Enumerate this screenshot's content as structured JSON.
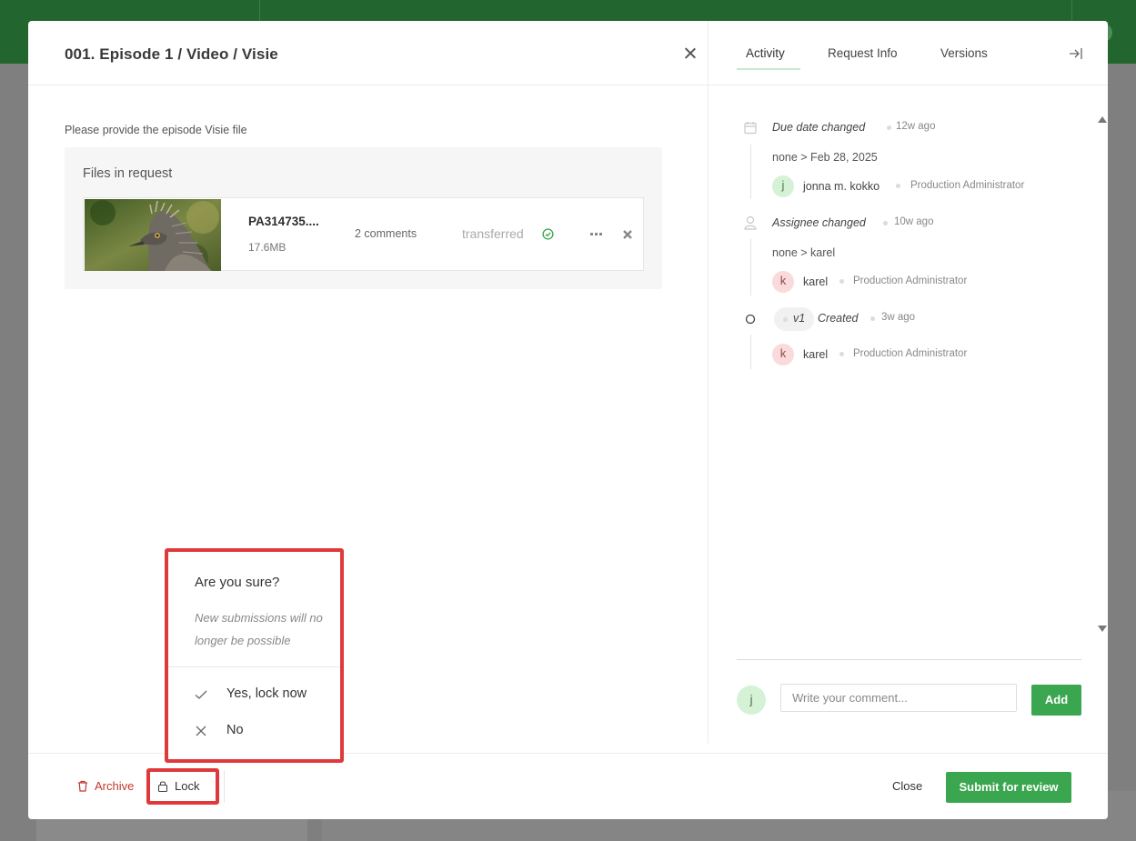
{
  "modal": {
    "title": "001. Episode 1 / Video / Visie",
    "request_description": "Please provide the episode Visie file",
    "files_title": "Files in request",
    "file": {
      "name": "PA314735....",
      "size": "17.6MB",
      "comments": "2 comments",
      "status": "transferred"
    }
  },
  "sidebar": {
    "tabs": [
      {
        "label": "Activity",
        "active": true
      },
      {
        "label": "Request Info",
        "active": false
      },
      {
        "label": "Versions",
        "active": false
      }
    ],
    "activity": [
      {
        "event": "Due date changed",
        "time": "12w ago",
        "change": "none > Feb 28, 2025",
        "user_initial": "j",
        "user": "jonna m. kokko",
        "role": "Production Administrator"
      },
      {
        "event": "Assignee changed",
        "time": "10w ago",
        "change": "none > karel",
        "user_initial": "k",
        "user": "karel",
        "role": "Production Administrator"
      },
      {
        "version": "v1",
        "event": "Created",
        "time": "3w ago",
        "user_initial": "k",
        "user": "karel",
        "role": "Production Administrator"
      }
    ],
    "comment": {
      "avatar_initial": "j",
      "placeholder": "Write your comment...",
      "add_label": "Add"
    }
  },
  "footer": {
    "archive_label": "Archive",
    "lock_label": "Lock",
    "close_label": "Close",
    "submit_label": "Submit for review"
  },
  "lock_confirm": {
    "title": "Are you sure?",
    "description": "New submissions will no longer be possible",
    "yes_label": "Yes, lock now",
    "no_label": "No"
  },
  "colors": {
    "brand_green": "#22652e",
    "button_green": "#3aa64f",
    "danger_red": "#c0392b",
    "highlight_red": "#e0393a"
  }
}
